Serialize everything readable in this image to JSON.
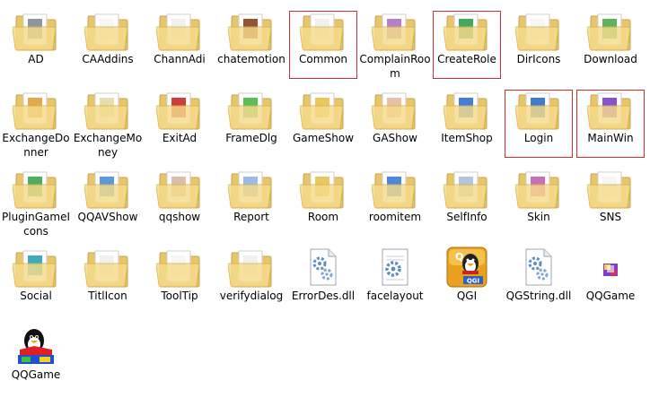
{
  "window": {
    "background": "#ffffff",
    "highlight_color": "#d62b2b"
  },
  "items": [
    {
      "label": "AD",
      "kind": "folder",
      "icon": "folder-icon",
      "accent": "#7d8b96"
    },
    {
      "label": "CAAddins",
      "kind": "folder",
      "icon": "folder-icon",
      "accent": "#f5f5f5"
    },
    {
      "label": "ChannAdi",
      "kind": "folder",
      "icon": "folder-icon",
      "accent": "#f0f0f0"
    },
    {
      "label": "chatemotion",
      "kind": "folder",
      "icon": "folder-icon",
      "accent": "#8a3f1e"
    },
    {
      "label": "Common",
      "kind": "folder",
      "icon": "folder-icon",
      "accent": "#f0f0f0",
      "highlight": true
    },
    {
      "label": "ComplainRoom",
      "kind": "folder",
      "icon": "folder-icon",
      "accent": "#b070c0"
    },
    {
      "label": "CreateRole",
      "kind": "folder",
      "icon": "folder-icon",
      "accent": "#2e9e4a",
      "highlight": true
    },
    {
      "label": "DirIcons",
      "kind": "folder",
      "icon": "folder-icon",
      "accent": "#f5f5f5"
    },
    {
      "label": "Download",
      "kind": "folder",
      "icon": "folder-icon",
      "accent": "#4caa4c"
    },
    {
      "label": "ExchangeDonner",
      "kind": "folder",
      "icon": "folder-icon",
      "accent": "#e0a03a"
    },
    {
      "label": "ExchangeMoney",
      "kind": "folder",
      "icon": "folder-icon",
      "accent": "#e6d8a8"
    },
    {
      "label": "ExitAd",
      "kind": "folder",
      "icon": "folder-icon",
      "accent": "#c82828"
    },
    {
      "label": "FrameDlg",
      "kind": "folder",
      "icon": "folder-icon",
      "accent": "#44b844"
    },
    {
      "label": "GameShow",
      "kind": "folder",
      "icon": "folder-icon",
      "accent": "#e8c24a"
    },
    {
      "label": "GAShow",
      "kind": "folder",
      "icon": "folder-icon",
      "accent": "#e6b8a0"
    },
    {
      "label": "ItemShop",
      "kind": "folder",
      "icon": "folder-icon",
      "accent": "#2f6fd6"
    },
    {
      "label": "Login",
      "kind": "folder",
      "icon": "folder-icon",
      "accent": "#2a70c8",
      "highlight": true
    },
    {
      "label": "MainWin",
      "kind": "folder",
      "icon": "folder-icon",
      "accent": "#7b3fc8",
      "highlight": true,
      "selected": true
    },
    {
      "label": "PluginGameIcons",
      "kind": "folder",
      "icon": "folder-icon",
      "accent": "#3aa64a"
    },
    {
      "label": "QQAVShow",
      "kind": "folder",
      "icon": "folder-icon",
      "accent": "#4a8ed6"
    },
    {
      "label": "qqshow",
      "kind": "folder",
      "icon": "folder-icon",
      "accent": "#d8b8a0"
    },
    {
      "label": "Report",
      "kind": "folder",
      "icon": "folder-icon",
      "accent": "#8fb4e0"
    },
    {
      "label": "Room",
      "kind": "folder",
      "icon": "folder-icon",
      "accent": "#e8c24a"
    },
    {
      "label": "roomitem",
      "kind": "folder",
      "icon": "folder-icon",
      "accent": "#3a7ad6"
    },
    {
      "label": "SelfInfo",
      "kind": "folder",
      "icon": "folder-icon",
      "accent": "#a6c0d8"
    },
    {
      "label": "Skin",
      "kind": "folder",
      "icon": "folder-icon",
      "accent": "#c060b0"
    },
    {
      "label": "SNS",
      "kind": "folder",
      "icon": "folder-icon",
      "accent": "#f5f5f5"
    },
    {
      "label": "Social",
      "kind": "folder",
      "icon": "folder-icon",
      "accent": "#2aa0b8"
    },
    {
      "label": "TitlIcon",
      "kind": "folder",
      "icon": "folder-icon",
      "accent": "#f0f0f0"
    },
    {
      "label": "ToolTip",
      "kind": "folder",
      "icon": "folder-icon",
      "accent": "#f5f5f5"
    },
    {
      "label": "verifydialog",
      "kind": "folder",
      "icon": "folder-icon",
      "accent": "#f0f0f0"
    },
    {
      "label": "ErrorDes.dll",
      "kind": "dll",
      "icon": "dll-gear-icon",
      "accent": "#5b8fc0"
    },
    {
      "label": "facelayout",
      "kind": "config",
      "icon": "config-gear-icon",
      "accent": "#5b8fc0"
    },
    {
      "label": "QGI",
      "kind": "qgi",
      "icon": "qq-penguin-icon",
      "accent": "#e8a020"
    },
    {
      "label": "QGString.dll",
      "kind": "dll",
      "icon": "dll-gear-icon",
      "accent": "#5b8fc0"
    },
    {
      "label": "QQGame",
      "kind": "exe-small",
      "icon": "qqgame-small-icon",
      "accent": "#8040c0"
    },
    {
      "label": "QQGame",
      "kind": "exe",
      "icon": "qqgame-penguin-icon",
      "accent": "#2050d0"
    }
  ]
}
